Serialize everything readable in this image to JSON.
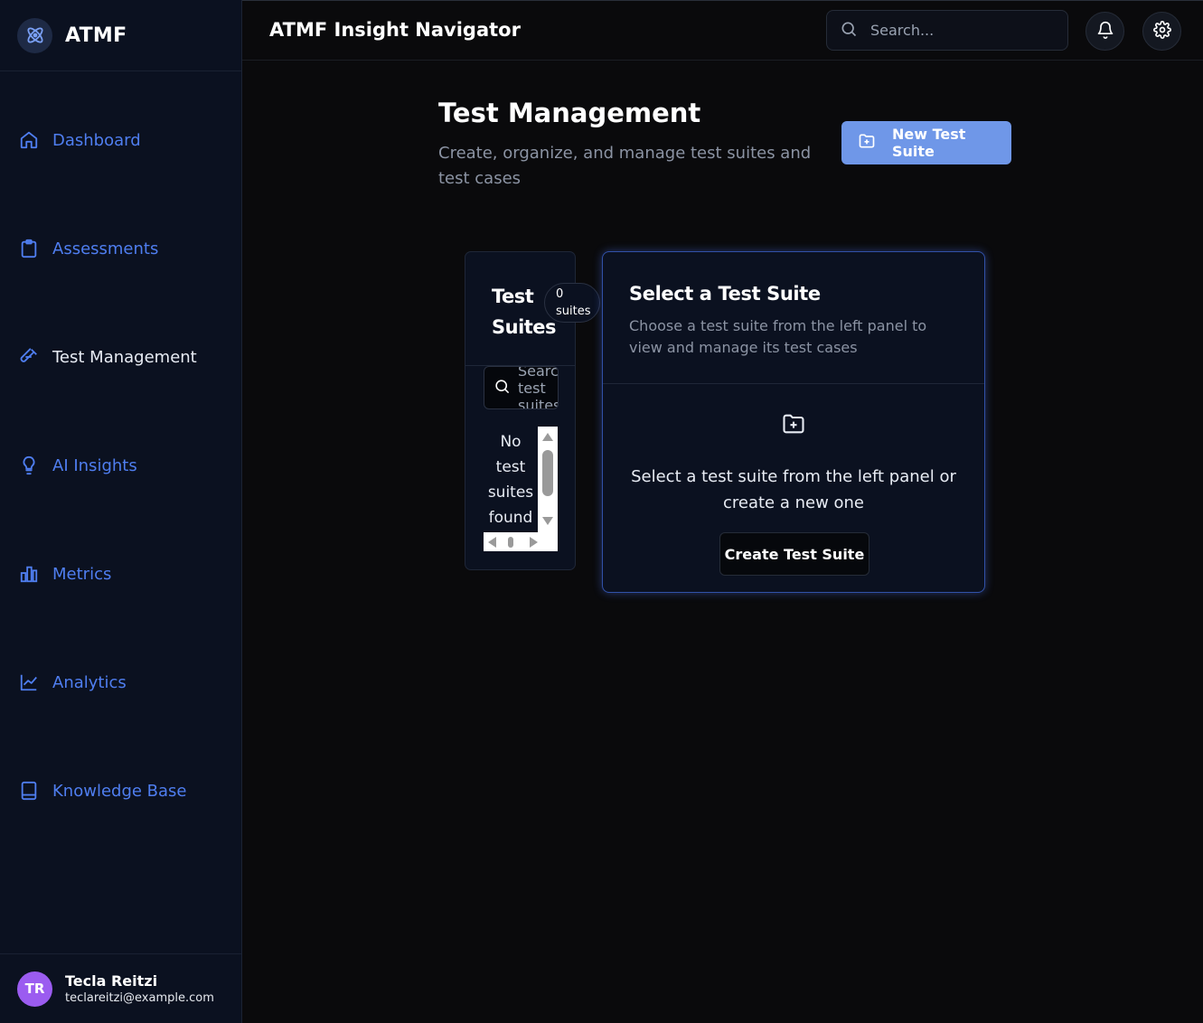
{
  "brand": {
    "name": "ATMF"
  },
  "header": {
    "title": "ATMF Insight Navigator",
    "search_placeholder": "Search..."
  },
  "sidebar": {
    "items": [
      {
        "label": "Dashboard",
        "icon": "home-icon"
      },
      {
        "label": "Assessments",
        "icon": "clipboard-icon"
      },
      {
        "label": "Test Management",
        "icon": "test-tube-icon",
        "active": true
      },
      {
        "label": "AI Insights",
        "icon": "lightbulb-icon"
      },
      {
        "label": "Metrics",
        "icon": "bar-chart-icon"
      },
      {
        "label": "Analytics",
        "icon": "line-chart-icon"
      },
      {
        "label": "Knowledge Base",
        "icon": "book-icon"
      }
    ]
  },
  "user": {
    "initials": "TR",
    "name": "Tecla Reitzi",
    "email": "teclareitzi@example.com"
  },
  "main": {
    "title": "Test Management",
    "subtitle": "Create, organize, and manage test suites and test cases",
    "new_button": "New Test Suite"
  },
  "suites_panel": {
    "title": "Test Suites",
    "count": "0",
    "count_unit": "suites",
    "search_placeholder": "Search test suites...",
    "empty_text": "No test suites found"
  },
  "detail_panel": {
    "title": "Select a Test Suite",
    "description": "Choose a test suite from the left panel to view and manage its test cases",
    "message": "Select a test suite from the left panel or create a new one",
    "create_button": "Create Test Suite"
  },
  "colors": {
    "accent": "#4f7ef0",
    "button": "#6f97e8",
    "avatar": "#9b5cf0",
    "sidebar_bg": "#0b1120"
  }
}
